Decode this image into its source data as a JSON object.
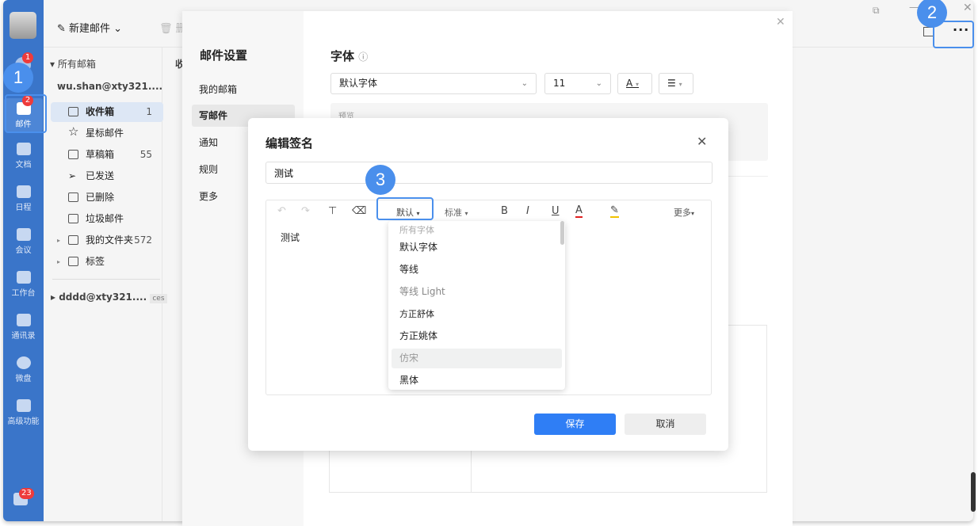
{
  "rail": {
    "items": [
      {
        "label": "邮件",
        "badge": "2"
      },
      {
        "label": "文档"
      },
      {
        "label": "日程"
      },
      {
        "label": "会议"
      },
      {
        "label": "工作台"
      },
      {
        "label": "通讯录"
      },
      {
        "label": "微盘"
      },
      {
        "label": "高级功能"
      }
    ],
    "top_badge": "1",
    "bottom_badge": "23"
  },
  "toolbar": {
    "new_mail": "新建邮件",
    "delete": "删"
  },
  "folders": {
    "all": "所有邮箱",
    "account": "wu.shan@xty321....",
    "items": [
      {
        "label": "收件箱",
        "count": "1"
      },
      {
        "label": "星标邮件",
        "count": ""
      },
      {
        "label": "草稿箱",
        "count": "55"
      },
      {
        "label": "已发送",
        "count": ""
      },
      {
        "label": "已删除",
        "count": ""
      },
      {
        "label": "垃圾邮件",
        "count": ""
      },
      {
        "label": "我的文件夹",
        "count": "572"
      },
      {
        "label": "标签",
        "count": ""
      }
    ],
    "account2": "dddd@xty321....",
    "account2_tag": "ces"
  },
  "list": {
    "header": "收"
  },
  "settings": {
    "title": "邮件设置",
    "nav": [
      "我的邮箱",
      "写邮件",
      "通知",
      "规则",
      "更多"
    ],
    "font_heading": "字体",
    "font_value": "默认字体",
    "size_value": "11",
    "preview_label": "预览"
  },
  "signature": {
    "title": "编辑签名",
    "name_value": "测试",
    "body": "测试",
    "toolbar": {
      "font": "默认",
      "size": "标准",
      "bold": "B",
      "italic": "I",
      "underline": "U",
      "color": "A",
      "more": "更多"
    },
    "save": "保存",
    "cancel": "取消"
  },
  "font_dropdown": {
    "header": "所有字体",
    "items": [
      "默认字体",
      "等线",
      "等线 Light",
      "方正舒体",
      "方正姚体",
      "仿宋",
      "黑体"
    ],
    "hovered": "仿宋"
  },
  "callouts": [
    "1",
    "2",
    "3"
  ],
  "colors": {
    "rail": "#3a75c9",
    "accent": "#2f7ef5",
    "callout": "#4a8fec",
    "badge": "#ee3b3b"
  }
}
